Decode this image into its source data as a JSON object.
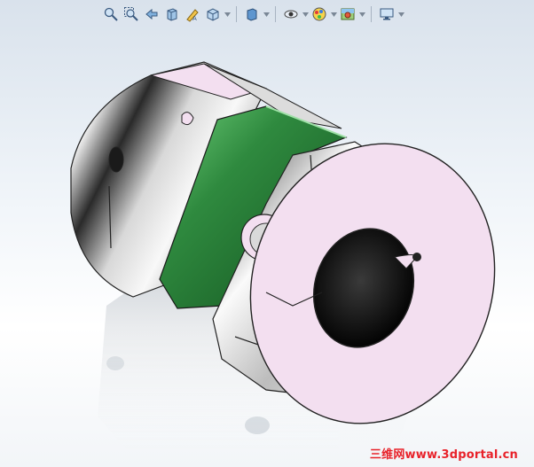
{
  "viewport": {
    "model_name": "disc coupling",
    "background_top": "#d9e2ec",
    "background_bottom": "#ffffff"
  },
  "toolbar": {
    "buttons": [
      {
        "name": "zoom-to-fit-button",
        "icon": "zoom-to-fit-icon"
      },
      {
        "name": "zoom-to-area-button",
        "icon": "zoom-to-area-icon"
      },
      {
        "name": "previous-view-button",
        "icon": "previous-view-icon"
      },
      {
        "name": "section-view-button",
        "icon": "section-view-icon"
      },
      {
        "name": "dynamic-annotation-button",
        "icon": "dynamic-annotation-icon"
      },
      {
        "name": "view-orientation-button",
        "icon": "view-orientation-icon"
      },
      {
        "name": "display-style-button",
        "icon": "display-style-icon"
      },
      {
        "name": "hide-show-items-button",
        "icon": "hide-show-icon"
      },
      {
        "name": "edit-appearance-button",
        "icon": "edit-appearance-icon"
      },
      {
        "name": "apply-scene-button",
        "icon": "apply-scene-icon"
      },
      {
        "name": "view-settings-button",
        "icon": "view-settings-icon"
      }
    ]
  },
  "colors": {
    "hub_face": "#f3dff0",
    "hub_body": "#c8ccd0",
    "spacer_green": "#2f8a3f",
    "bore_dark": "#1a1a1a",
    "edge": "#222222"
  },
  "watermark": {
    "text": "三维网www.3dportal.cn",
    "color": "#e8222a"
  }
}
